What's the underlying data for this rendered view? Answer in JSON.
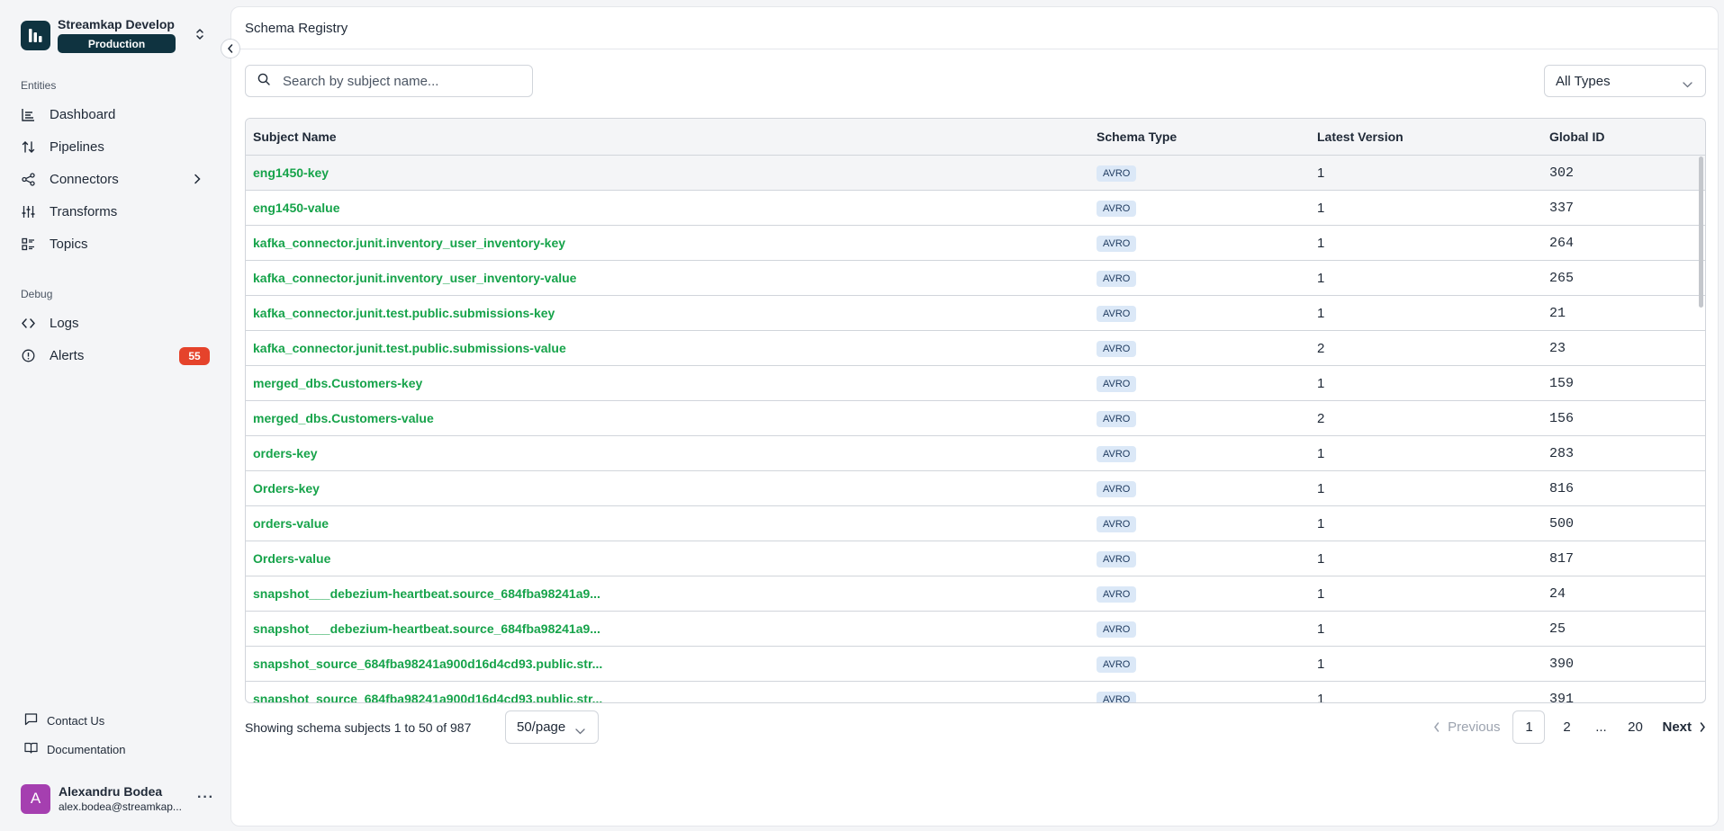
{
  "org": {
    "name": "Streamkap Develop",
    "environment": "Production"
  },
  "nav": {
    "entities_label": "Entities",
    "entities": [
      {
        "label": "Dashboard",
        "icon": "chart-icon"
      },
      {
        "label": "Pipelines",
        "icon": "arrows-updown-icon"
      },
      {
        "label": "Connectors",
        "icon": "share-icon"
      },
      {
        "label": "Transforms",
        "icon": "sliders-icon"
      },
      {
        "label": "Topics",
        "icon": "list-icon"
      }
    ],
    "debug_label": "Debug",
    "debug": [
      {
        "label": "Logs",
        "icon": "code-icon"
      },
      {
        "label": "Alerts",
        "icon": "alert-circle-icon",
        "badge": "55"
      }
    ]
  },
  "footer_links": {
    "contact": "Contact Us",
    "docs": "Documentation"
  },
  "user": {
    "initial": "A",
    "name": "Alexandru Bodea",
    "email": "alex.bodea@streamkap..."
  },
  "page": {
    "title": "Schema Registry"
  },
  "search": {
    "placeholder": "Search by subject name..."
  },
  "type_filter": {
    "selected": "All Types"
  },
  "table": {
    "headers": {
      "name": "Subject Name",
      "type": "Schema Type",
      "version": "Latest Version",
      "id": "Global ID"
    },
    "rows": [
      {
        "name": "eng1450-key",
        "type": "AVRO",
        "version": "1",
        "id": "302"
      },
      {
        "name": "eng1450-value",
        "type": "AVRO",
        "version": "1",
        "id": "337"
      },
      {
        "name": "kafka_connector.junit.inventory_user_inventory-key",
        "type": "AVRO",
        "version": "1",
        "id": "264"
      },
      {
        "name": "kafka_connector.junit.inventory_user_inventory-value",
        "type": "AVRO",
        "version": "1",
        "id": "265"
      },
      {
        "name": "kafka_connector.junit.test.public.submissions-key",
        "type": "AVRO",
        "version": "1",
        "id": "21"
      },
      {
        "name": "kafka_connector.junit.test.public.submissions-value",
        "type": "AVRO",
        "version": "2",
        "id": "23"
      },
      {
        "name": "merged_dbs.Customers-key",
        "type": "AVRO",
        "version": "1",
        "id": "159"
      },
      {
        "name": "merged_dbs.Customers-value",
        "type": "AVRO",
        "version": "2",
        "id": "156"
      },
      {
        "name": "orders-key",
        "type": "AVRO",
        "version": "1",
        "id": "283"
      },
      {
        "name": "Orders-key",
        "type": "AVRO",
        "version": "1",
        "id": "816"
      },
      {
        "name": "orders-value",
        "type": "AVRO",
        "version": "1",
        "id": "500"
      },
      {
        "name": "Orders-value",
        "type": "AVRO",
        "version": "1",
        "id": "817"
      },
      {
        "name": "snapshot___debezium-heartbeat.source_684fba98241a9...",
        "type": "AVRO",
        "version": "1",
        "id": "24"
      },
      {
        "name": "snapshot___debezium-heartbeat.source_684fba98241a9...",
        "type": "AVRO",
        "version": "1",
        "id": "25"
      },
      {
        "name": "snapshot_source_684fba98241a900d16d4cd93.public.str...",
        "type": "AVRO",
        "version": "1",
        "id": "390"
      },
      {
        "name": "snapshot_source_684fba98241a900d16d4cd93.public.str...",
        "type": "AVRO",
        "version": "1",
        "id": "391"
      }
    ]
  },
  "pagination": {
    "showing": "Showing schema subjects 1 to 50 of 987",
    "per_page": "50/page",
    "prev": "Previous",
    "pages": [
      "1",
      "2",
      "...",
      "20"
    ],
    "next": "Next"
  },
  "colors": {
    "brand": "#0f3340",
    "link": "#16a34a",
    "badge": "#e5432b",
    "avatar": "#a53fb0"
  }
}
